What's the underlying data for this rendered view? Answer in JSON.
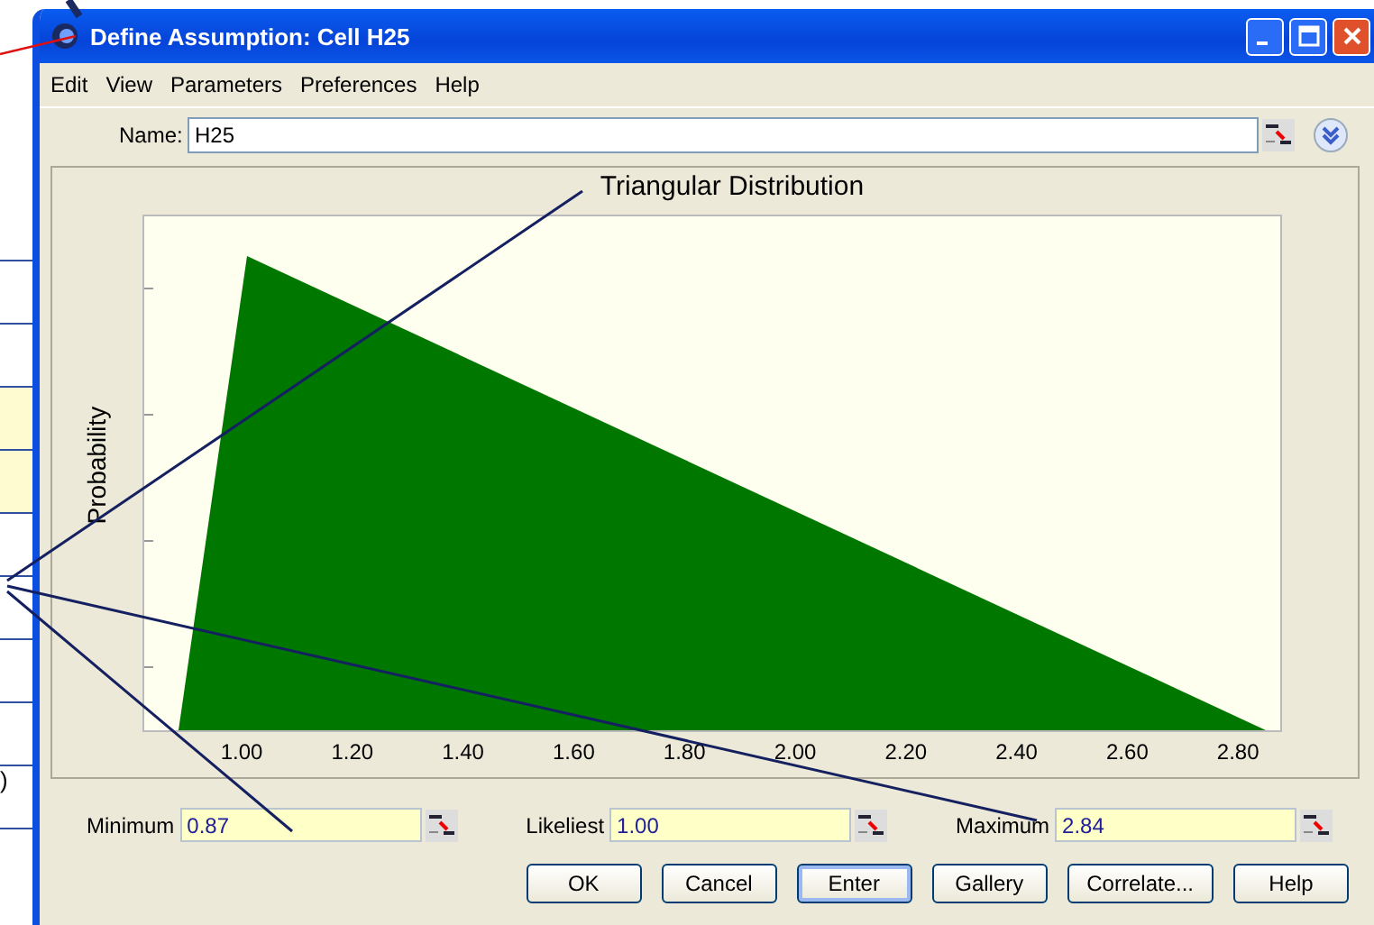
{
  "background_sheet": {
    "partial_text": ")"
  },
  "window": {
    "title": "Define Assumption: Cell H25"
  },
  "menu": [
    "Edit",
    "View",
    "Parameters",
    "Preferences",
    "Help"
  ],
  "name_field": {
    "label": "Name:",
    "value": "H25"
  },
  "chart": {
    "title": "Triangular Distribution",
    "ylabel": "Probability",
    "xtick_labels": [
      "1.00",
      "1.20",
      "1.40",
      "1.60",
      "1.80",
      "2.00",
      "2.20",
      "2.40",
      "2.60",
      "2.80"
    ]
  },
  "parameters": [
    {
      "label": "Minimum",
      "value": "0.87"
    },
    {
      "label": "Likeliest",
      "value": "1.00"
    },
    {
      "label": "Maximum",
      "value": "2.84"
    }
  ],
  "buttons": [
    {
      "label": "OK",
      "default": false
    },
    {
      "label": "Cancel",
      "default": false
    },
    {
      "label": "Enter",
      "default": true
    },
    {
      "label": "Gallery",
      "default": false
    },
    {
      "label": "Correlate...",
      "default": false
    },
    {
      "label": "Help",
      "default": false
    }
  ]
}
